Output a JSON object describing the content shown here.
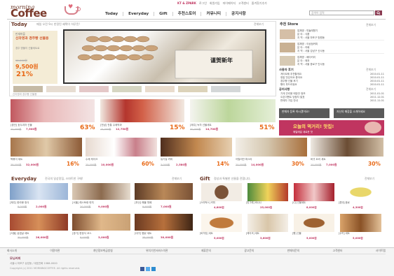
{
  "brand": {
    "line1": "morning",
    "line2": "Coffee"
  },
  "top_links": [
    "KT & ZPARK",
    "로그인",
    "회원가입",
    "마이페이지",
    "고객센터",
    "즐겨찾기추가"
  ],
  "nav": [
    "Today",
    "Everyday",
    "Gift",
    "추천스토어",
    "커뮤니티",
    "공지사항"
  ],
  "search": {
    "placeholder": "검색어 입력"
  },
  "today": {
    "title": "Today",
    "subtitle": "매일 오전 9시 한정된 혜택이 하루된!",
    "more": "전체보기",
    "promo": {
      "tag": "만세마을",
      "name": "신라명과 경주빵 선물용",
      "desc": "경주 명물이 선물세트로",
      "price_old": "12,000원",
      "price": "9,500원",
      "pct": "21%"
    },
    "stamp": "谨贺新年",
    "thumb_caption": "신라명과 경주빵 선물용"
  },
  "store": {
    "title": "추천 Store",
    "more": "전체보기",
    "items": [
      {
        "l1": "업체명 : 민들레향기",
        "l2": "분 야 : 식품",
        "l3": "지 역 : 서울 마포구 망원동"
      },
      {
        "l1": "업체명 : 이상점커피",
        "l2": "분 야 : 카페",
        "l3": "지 역 : 서울 강남구 신사동"
      },
      {
        "l1": "업체명 : 베이커리",
        "l2": "분 야 : 제과",
        "l3": "지 역 : 서울 종로구 인사동"
      }
    ]
  },
  "notice": {
    "title": "사용자 후기",
    "more": "전체보기",
    "items": [
      [
        "게이트웨 추천할게요",
        "2010.01.11"
      ],
      [
        "정말 맛있어요 좋아요",
        "2010.01.11"
      ],
      [
        "경주빵 선물 후기",
        "2010.01.11"
      ],
      [
        "빵이 부드러워요",
        "2010.01.11"
      ]
    ]
  },
  "notice2": {
    "title": "공지사항",
    "more": "전체보기",
    "items": [
      [
        "가게 관리용 매장안 정보",
        "2011.01.01"
      ],
      [
        "오픈이벤트 당첨자 발표",
        "2011.12.01"
      ],
      [
        "판매자 가입 안내",
        "2011.11.01"
      ]
    ]
  },
  "side_btns": [
    "판매자 등록 하시겠어요?",
    "자신의 매장을 소개하세요"
  ],
  "pink_banner": {
    "text": "오늘의 먹거리! 맛집!",
    "sub": "매일매일 새로운 맛"
  },
  "deals_row1": [
    {
      "cap": "[경인] 호두과자 선물",
      "old": "20,000원",
      "now": "7,500원",
      "pct": "63%"
    },
    {
      "cap": "[전남] 전통 수제약과",
      "old": "15,000원",
      "now": "12,750원",
      "pct": "15%"
    },
    {
      "cap": "[제주] 녹차 선물세트",
      "old": "30,000원",
      "now": "14,700원",
      "pct": "51%"
    }
  ],
  "deals_row2": [
    {
      "cap": "떡볶이 세트",
      "old": "38,000원",
      "now": "32,000원",
      "pct": "16%"
    },
    {
      "cap": "수제 케이크",
      "old": "25,000원",
      "now": "10,000원",
      "pct": "60%"
    },
    {
      "cap": "유기농 커피",
      "old": "3,000원",
      "now": "2,580원",
      "pct": "14%"
    },
    {
      "cap": "이탈리안 파스타",
      "old": "20,000원",
      "now": "14,000원",
      "pct": "30%"
    },
    {
      "cap": "버섯 요리 세트",
      "old": "10,000원",
      "now": "7,000원",
      "pct": "30%"
    }
  ],
  "everyday": {
    "title": "Everyday",
    "subtitle": "전국의 일상맛집, 스마트한 구매!",
    "more": "전체보기",
    "items": [
      {
        "cap": "[제주] 한라봉 정식",
        "old": "8,000원",
        "now": "2,000원"
      },
      {
        "cap": "[서울] 레스토랑 런치",
        "old": "20,000원",
        "now": "9,000원"
      },
      {
        "cap": "[부산] 해물 뷔페",
        "old": "9,900원",
        "now": "7,000원"
      },
      {
        "cap": "[서울] 삼겹살 세트",
        "old": "30,000원",
        "now": "26,000원"
      },
      {
        "cap": "[경기] 한정식 코스",
        "old": "8,000원",
        "now": "3,000원"
      },
      {
        "cap": "[대구] 찜닭 세트",
        "old": "38,000원",
        "now": "30,000원"
      }
    ]
  },
  "gift": {
    "title": "Gift",
    "subtitle": "정성과 특별한 선물을 전합니다.",
    "more": "전체보기",
    "items": [
      {
        "cap": "[스타벅스] 커피",
        "now": "4,800원"
      },
      {
        "cap": "[빙그레] 바나나",
        "now": "25,000원"
      },
      {
        "cap": "[CJ] 선물세트",
        "now": "8,000원"
      },
      {
        "cap": "[롯데] 음료",
        "now": "4,300원"
      },
      {
        "cap": "[버거킹] 세트",
        "now": "5,000원"
      },
      {
        "cap": "[케이크] 세트",
        "now": "3,600원"
      },
      {
        "cap": "[빵] 선물",
        "now": "5,000원"
      },
      {
        "cap": "[쿠키] 세트",
        "now": "5,000원"
      }
    ]
  },
  "footer": {
    "links": [
      "회사소개",
      "이용약관",
      "개인정보취급방침",
      "위치기반서비스약관",
      "제휴문의",
      "광고문의",
      "판매자문의",
      "고객센터",
      "사이트맵"
    ],
    "company": "모닝커피",
    "addr": "서울시 마포구 상암동 / 대표전화 1588-0000",
    "copy": "Copyright (c) 2011 MORNINGCOFFEE. All rights reserved."
  }
}
